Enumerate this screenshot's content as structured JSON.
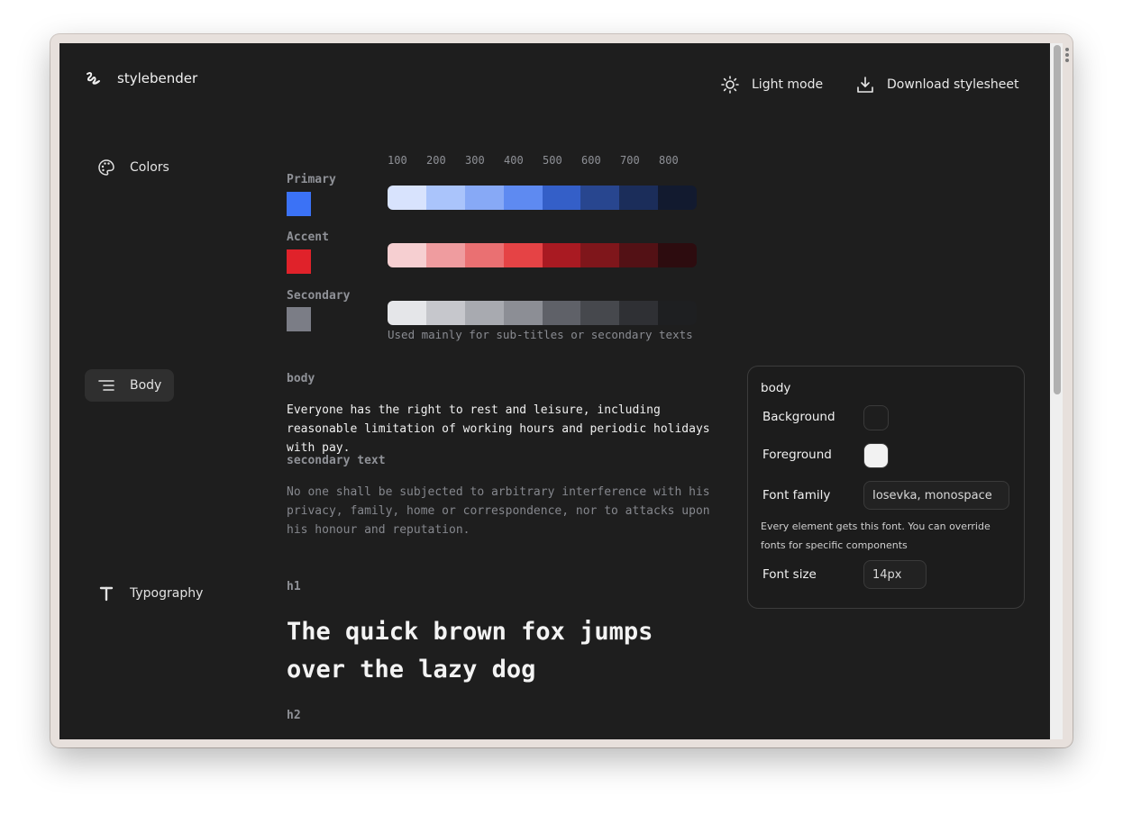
{
  "app": {
    "name": "stylebender"
  },
  "header": {
    "light_mode": "Light mode",
    "download": "Download stylesheet"
  },
  "nav": {
    "colors": "Colors",
    "body": "Body",
    "typography": "Typography"
  },
  "colors": {
    "ticks": [
      "100",
      "200",
      "300",
      "400",
      "500",
      "600",
      "700",
      "800"
    ],
    "primary": {
      "label": "Primary",
      "swatch": "#3b72f6",
      "ramp": [
        "#d8e3fd",
        "#aac4fb",
        "#87a9f6",
        "#5e8af1",
        "#345fc8",
        "#28468f",
        "#1b2d5a",
        "#121a2f"
      ]
    },
    "accent": {
      "label": "Accent",
      "swatch": "#e0222a",
      "ramp": [
        "#f6cfd1",
        "#ef9c9f",
        "#ea7072",
        "#e54345",
        "#a91a22",
        "#7f161b",
        "#531115",
        "#2d0c0f"
      ]
    },
    "secondary": {
      "label": "Secondary",
      "swatch": "#7b7d86",
      "caption": "Used mainly for sub-titles or secondary texts",
      "ramp": [
        "#e5e6e9",
        "#c6c7cc",
        "#a8aab0",
        "#8c8e95",
        "#5f6168",
        "#46484d",
        "#2f3034",
        "#1e1f21"
      ]
    }
  },
  "body_section": {
    "label": "body",
    "text": "Everyone has the right to rest and leisure, including reasonable limitation of working hours and periodic holidays with pay.",
    "secondary_label": "secondary text",
    "secondary_text": "No one shall be subjected to arbitrary interference with his privacy, family, home or correspondence, nor to attacks upon his honour and reputation."
  },
  "panel": {
    "title": "body",
    "background_label": "Background",
    "background_color": "#1e1e1e",
    "foreground_label": "Foreground",
    "foreground_color": "#f2f2f2",
    "font_family_label": "Font family",
    "font_family_value": "Iosevka, monospace",
    "note": "Every element gets this font. You can override fonts for specific components",
    "font_size_label": "Font size",
    "font_size_value": "14px"
  },
  "typography": {
    "h1_label": "h1",
    "h1_text": "The quick brown fox jumps over the lazy dog",
    "h2_label": "h2"
  }
}
